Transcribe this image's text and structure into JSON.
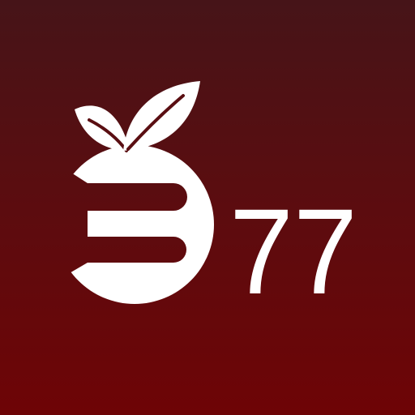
{
  "icon": {
    "brand_number": "77",
    "logo_name": "apple-e-logo",
    "colors": {
      "background_top": "#461418",
      "background_bottom": "#6e0406",
      "foreground": "#ffffff"
    }
  }
}
